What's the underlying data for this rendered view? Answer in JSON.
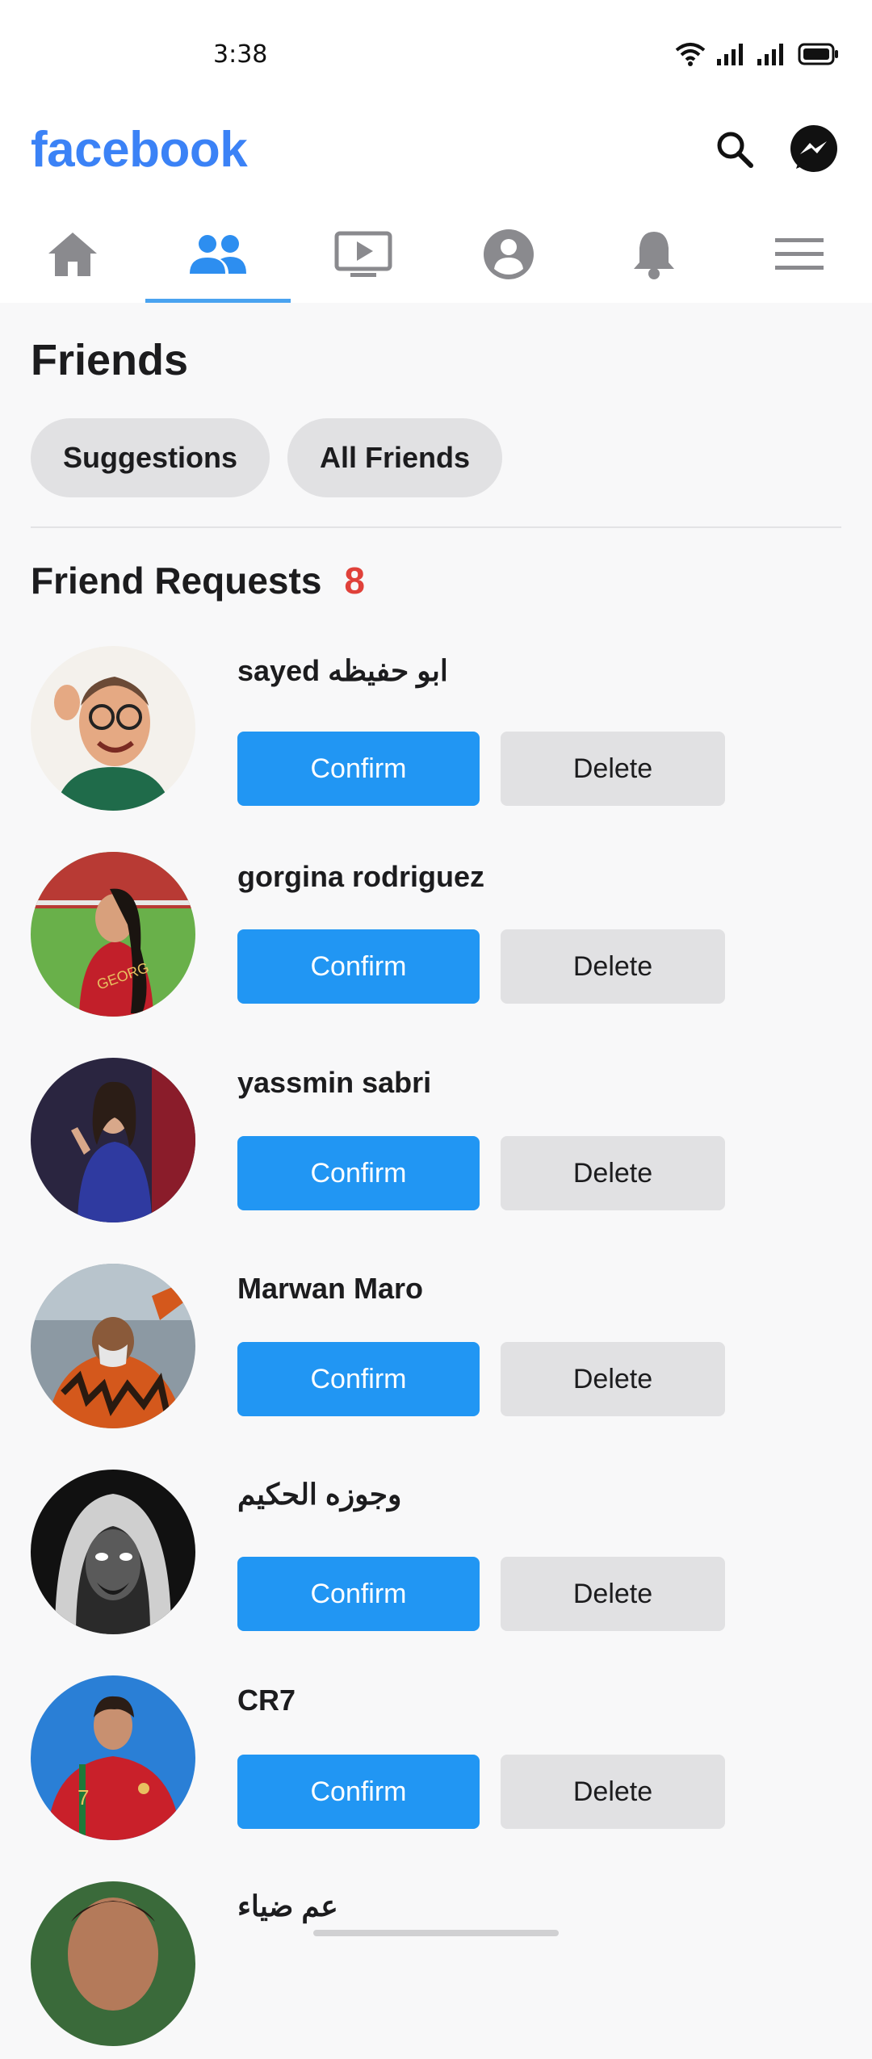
{
  "status_bar": {
    "time": "3:38",
    "icons": [
      "wifi-icon",
      "signal-icon",
      "signal-icon",
      "battery-icon"
    ]
  },
  "header": {
    "logo": "facebook",
    "actions": [
      "search-icon",
      "messenger-icon"
    ],
    "brand_color": "#3b82f6"
  },
  "nav": {
    "tabs": [
      {
        "icon": "home-icon",
        "active": false
      },
      {
        "icon": "friends-icon",
        "active": true
      },
      {
        "icon": "watch-icon",
        "active": false
      },
      {
        "icon": "profile-icon",
        "active": false
      },
      {
        "icon": "bell-icon",
        "active": false
      },
      {
        "icon": "menu-icon",
        "active": false
      }
    ],
    "active_color": "#4aa3f0"
  },
  "page": {
    "title": "Friends",
    "chips": [
      "Suggestions",
      "All Friends"
    ]
  },
  "requests": {
    "title": "Friend Requests",
    "count": "8",
    "count_color": "#e0413a",
    "confirm_label": "Confirm",
    "delete_label": "Delete",
    "confirm_color": "#2196f3",
    "items": [
      {
        "name": "sayed ابو حفيظه"
      },
      {
        "name": "gorgina rodriguez"
      },
      {
        "name": "yassmin sabri"
      },
      {
        "name": "Marwan Maro"
      },
      {
        "name": "وجوزه الحكيم"
      },
      {
        "name": "CR7"
      },
      {
        "name": "عم ضياء"
      }
    ]
  }
}
